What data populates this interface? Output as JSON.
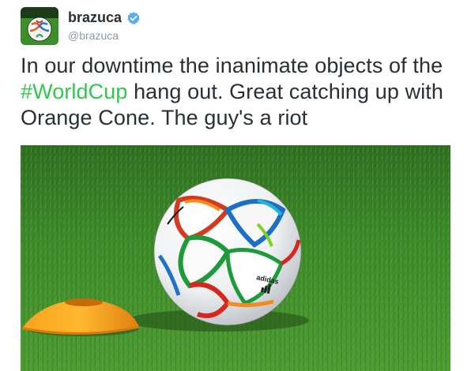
{
  "user": {
    "display_name": "brazuca",
    "handle": "@brazuca",
    "verified": true,
    "avatar_icon": "soccer-ball-avatar"
  },
  "tweet": {
    "text_before": "In our downtime the inanimate objects of the ",
    "hashtag": "#WorldCup",
    "text_after": " hang out. Great catching up with Orange Cone. The guy's a riot"
  },
  "media": {
    "description_icon": "photo-soccer-ball-and-cone",
    "ball_brand": "adidas"
  },
  "colors": {
    "hashtag": "#2ec94a",
    "verified": "#55acee",
    "grass": "#3f8a2a",
    "cone": "#f59d1a"
  }
}
